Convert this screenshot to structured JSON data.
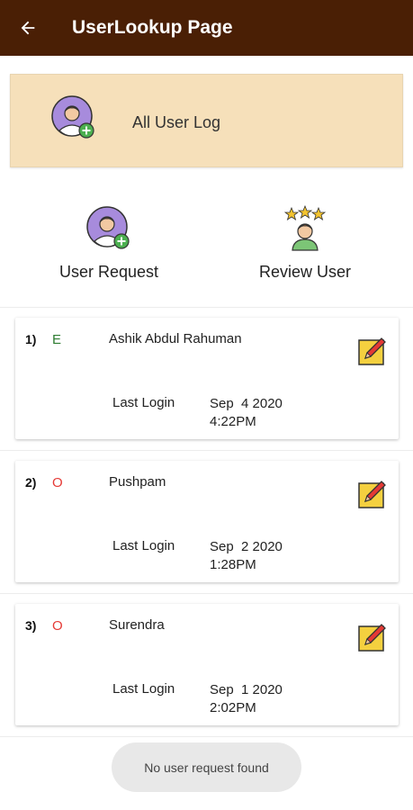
{
  "header": {
    "title": "UserLookup Page",
    "back_icon": "arrow-left-icon"
  },
  "all_user_log": {
    "label": "All User Log",
    "icon": "user-add-icon"
  },
  "actions": [
    {
      "label": "User Request",
      "icon": "user-add-icon"
    },
    {
      "label": "Review User",
      "icon": "user-stars-icon"
    }
  ],
  "users": [
    {
      "index": "1)",
      "status": "E",
      "status_color": "#2e7d32",
      "name": "Ashik Abdul Rahuman",
      "last_login_label": "Last Login",
      "date": "Sep  4 2020",
      "time": "4:22PM"
    },
    {
      "index": "2)",
      "status": "O",
      "status_color": "#e53935",
      "name": "Pushpam",
      "last_login_label": "Last Login",
      "date": "Sep  2 2020",
      "time": "1:28PM"
    },
    {
      "index": "3)",
      "status": "O",
      "status_color": "#e53935",
      "name": "Surendra",
      "last_login_label": "Last Login",
      "date": "Sep  1 2020",
      "time": "2:02PM"
    }
  ],
  "toast": {
    "message": "No user request found"
  },
  "colors": {
    "appbar": "#4a1f05",
    "panel": "#f6e0ba",
    "edit_icon": "#f4d03f"
  }
}
